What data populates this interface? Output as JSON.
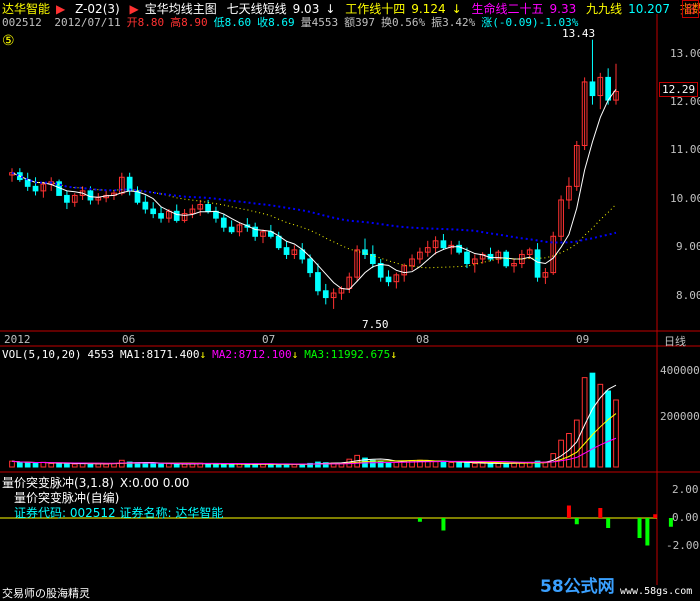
{
  "header": {
    "stock_name": "达华智能",
    "indicator_code": "Z-02(3)",
    "main_chart_name": "宝华均线主图",
    "line1": {
      "label": "七天线短线",
      "value": "9.03"
    },
    "line2": {
      "label": "工作线十四",
      "value": "9.124"
    },
    "line3": {
      "label": "生命线二十五",
      "value": "9.33"
    },
    "line4": {
      "label": "九九线",
      "value": "10.207"
    },
    "extra": "指数",
    "code": "002512",
    "date": "2012/07/11",
    "open": {
      "label": "开",
      "value": "8.80"
    },
    "high": {
      "label": "高",
      "value": "8.90"
    },
    "low": {
      "label": "低",
      "value": "8.60"
    },
    "close": {
      "label": "收",
      "value": "8.69"
    },
    "volume": {
      "label": "量",
      "value": "4553"
    },
    "amount": {
      "label": "额",
      "value": "397"
    },
    "turnover": {
      "label": "换",
      "value": "0.56%"
    },
    "amplitude": {
      "label": "振",
      "value": "3.42%"
    },
    "change": {
      "label": "涨",
      "value": "(-0.09)-1.03%"
    },
    "circle_badge": "⑤",
    "collapse_glyph": "日"
  },
  "price_axis": {
    "ticks": [
      "13.00",
      "12.00",
      "11.00",
      "10.00",
      "9.00",
      "8.00"
    ],
    "current_price": "12.29",
    "max_marker": "13.43",
    "min_marker": "7.50"
  },
  "time_axis": {
    "labels": [
      "2012",
      "06",
      "07",
      "08",
      "09"
    ],
    "period": "日线"
  },
  "volume_panel": {
    "title": "VOL(5,10,20)",
    "value": "4553",
    "ma1": {
      "label": "MA1:",
      "value": "8171.400"
    },
    "ma2": {
      "label": "MA2:",
      "value": "8712.100"
    },
    "ma3": {
      "label": "MA3:",
      "value": "11992.675"
    },
    "ticks": [
      "400000",
      "200000"
    ]
  },
  "indicator_panel": {
    "title": "量价突变脉冲",
    "params": "(3,1.8)",
    "x_value": "X:0.00 0.00",
    "subtitle": "量价突变脉冲(自编)",
    "code_label": "证券代码:",
    "code": "002512",
    "name_label": "证券名称:",
    "name": "达华智能",
    "ticks": [
      "2.00",
      "0.00",
      "-2.00"
    ]
  },
  "footer": {
    "brand": "交易师の股海精灵",
    "watermark": "58公式网",
    "url": "www.58gs.com"
  },
  "colors": {
    "up": "#ff3232",
    "down": "#00ffff",
    "ma_short": "#ffffff",
    "ma_long": "#0000ff",
    "vol_ma1": "#ffffff",
    "vol_ma2": "#ffff00",
    "vol_ma3": "#ff00ff",
    "pulse_up": "#ff0000",
    "pulse_down": "#00ff00"
  },
  "chart_data": {
    "type": "candlestick",
    "price_range": [
      7.3,
      13.6
    ],
    "candles": [
      [
        10.45,
        10.6,
        10.3,
        10.5
      ],
      [
        10.5,
        10.6,
        10.3,
        10.35
      ],
      [
        10.35,
        10.5,
        10.1,
        10.2
      ],
      [
        10.2,
        10.4,
        10.0,
        10.1
      ],
      [
        10.1,
        10.3,
        9.95,
        10.25
      ],
      [
        10.25,
        10.4,
        10.1,
        10.3
      ],
      [
        10.3,
        10.35,
        10.0,
        10.0
      ],
      [
        10.0,
        10.1,
        9.7,
        9.85
      ],
      [
        9.85,
        10.05,
        9.75,
        10.0
      ],
      [
        10.0,
        10.2,
        9.9,
        10.1
      ],
      [
        10.1,
        10.2,
        9.8,
        9.9
      ],
      [
        9.9,
        10.05,
        9.8,
        9.95
      ],
      [
        9.95,
        10.1,
        9.85,
        10.0
      ],
      [
        10.0,
        10.1,
        9.9,
        10.05
      ],
      [
        10.05,
        10.5,
        10.0,
        10.4
      ],
      [
        10.4,
        10.5,
        10.0,
        10.1
      ],
      [
        10.1,
        10.2,
        9.8,
        9.85
      ],
      [
        9.85,
        10.0,
        9.6,
        9.7
      ],
      [
        9.7,
        9.85,
        9.5,
        9.6
      ],
      [
        9.6,
        9.75,
        9.4,
        9.5
      ],
      [
        9.5,
        9.7,
        9.4,
        9.65
      ],
      [
        9.65,
        9.8,
        9.4,
        9.45
      ],
      [
        9.45,
        9.7,
        9.4,
        9.6
      ],
      [
        9.6,
        9.8,
        9.5,
        9.7
      ],
      [
        9.7,
        9.9,
        9.55,
        9.8
      ],
      [
        9.8,
        9.9,
        9.6,
        9.65
      ],
      [
        9.65,
        9.75,
        9.4,
        9.5
      ],
      [
        9.5,
        9.6,
        9.2,
        9.3
      ],
      [
        9.3,
        9.45,
        9.15,
        9.2
      ],
      [
        9.2,
        9.4,
        9.1,
        9.35
      ],
      [
        9.35,
        9.5,
        9.2,
        9.3
      ],
      [
        9.3,
        9.4,
        9.0,
        9.1
      ],
      [
        9.1,
        9.25,
        8.95,
        9.2
      ],
      [
        9.2,
        9.35,
        9.05,
        9.1
      ],
      [
        9.1,
        9.2,
        8.8,
        8.85
      ],
      [
        8.85,
        9.0,
        8.6,
        8.7
      ],
      [
        8.7,
        8.9,
        8.6,
        8.8
      ],
      [
        8.8,
        8.95,
        8.5,
        8.6
      ],
      [
        8.6,
        8.7,
        8.2,
        8.3
      ],
      [
        8.3,
        8.5,
        7.8,
        7.9
      ],
      [
        7.9,
        8.05,
        7.6,
        7.75
      ],
      [
        7.75,
        7.95,
        7.5,
        7.85
      ],
      [
        7.85,
        8.0,
        7.7,
        7.95
      ],
      [
        7.95,
        8.3,
        7.85,
        8.2
      ],
      [
        8.2,
        8.9,
        8.1,
        8.8
      ],
      [
        8.8,
        9.05,
        8.6,
        8.7
      ],
      [
        8.7,
        8.9,
        8.4,
        8.5
      ],
      [
        8.5,
        8.6,
        8.1,
        8.2
      ],
      [
        8.2,
        8.35,
        8.0,
        8.1
      ],
      [
        8.1,
        8.3,
        7.95,
        8.25
      ],
      [
        8.25,
        8.5,
        8.1,
        8.45
      ],
      [
        8.45,
        8.7,
        8.35,
        8.6
      ],
      [
        8.6,
        8.85,
        8.5,
        8.75
      ],
      [
        8.75,
        9.0,
        8.65,
        8.85
      ],
      [
        8.85,
        9.1,
        8.7,
        9.0
      ],
      [
        9.0,
        9.15,
        8.8,
        8.85
      ],
      [
        8.85,
        9.0,
        8.7,
        8.9
      ],
      [
        8.9,
        9.0,
        8.7,
        8.75
      ],
      [
        8.75,
        8.85,
        8.4,
        8.5
      ],
      [
        8.5,
        8.7,
        8.3,
        8.6
      ],
      [
        8.6,
        8.75,
        8.5,
        8.7
      ],
      [
        8.7,
        8.85,
        8.55,
        8.6
      ],
      [
        8.6,
        8.8,
        8.5,
        8.75
      ],
      [
        8.75,
        8.8,
        8.4,
        8.45
      ],
      [
        8.45,
        8.6,
        8.3,
        8.5
      ],
      [
        8.5,
        8.8,
        8.4,
        8.7
      ],
      [
        8.7,
        8.85,
        8.6,
        8.8
      ],
      [
        8.8,
        8.95,
        8.1,
        8.2
      ],
      [
        8.2,
        8.4,
        8.05,
        8.3
      ],
      [
        8.3,
        9.2,
        8.25,
        9.1
      ],
      [
        9.1,
        10.0,
        9.0,
        9.9
      ],
      [
        9.9,
        10.4,
        9.7,
        10.2
      ],
      [
        10.2,
        11.2,
        10.1,
        11.1
      ],
      [
        11.1,
        12.6,
        11.0,
        12.5
      ],
      [
        12.5,
        13.43,
        12.0,
        12.2
      ],
      [
        12.2,
        12.7,
        11.9,
        12.6
      ],
      [
        12.6,
        12.8,
        12.0,
        12.1
      ],
      [
        12.1,
        12.9,
        12.0,
        12.29
      ]
    ],
    "volume": [
      26000,
      20000,
      18000,
      17000,
      21000,
      16000,
      15000,
      14000,
      13000,
      17000,
      16000,
      14000,
      13000,
      15000,
      30000,
      22000,
      19000,
      16000,
      15000,
      14000,
      15000,
      14000,
      13000,
      15000,
      17000,
      14000,
      13000,
      12000,
      11000,
      13000,
      12000,
      12000,
      13000,
      12000,
      13000,
      12000,
      11000,
      12000,
      16000,
      22000,
      19000,
      18000,
      17000,
      35000,
      52000,
      40000,
      30000,
      22000,
      20000,
      21000,
      25000,
      28000,
      30000,
      27000,
      24000,
      22000,
      20000,
      19000,
      18000,
      16000,
      17000,
      15000,
      16000,
      18000,
      17000,
      20000,
      21000,
      26000,
      22000,
      60000,
      120000,
      150000,
      210000,
      400000,
      420000,
      370000,
      340000,
      300000
    ],
    "pulse": [
      {
        "i": 52,
        "v": -0.3
      },
      {
        "i": 55,
        "v": -1.0
      },
      {
        "i": 71,
        "v": 1.0
      },
      {
        "i": 72,
        "v": -0.5
      },
      {
        "i": 75,
        "v": 0.8
      },
      {
        "i": 76,
        "v": -0.8
      },
      {
        "i": 80,
        "v": -1.6
      },
      {
        "i": 81,
        "v": -2.2
      },
      {
        "i": 82,
        "v": 0.3
      },
      {
        "i": 84,
        "v": -0.7
      }
    ],
    "volume_range": [
      0,
      470000
    ],
    "pulse_range": [
      -3.2,
      3.2
    ]
  }
}
